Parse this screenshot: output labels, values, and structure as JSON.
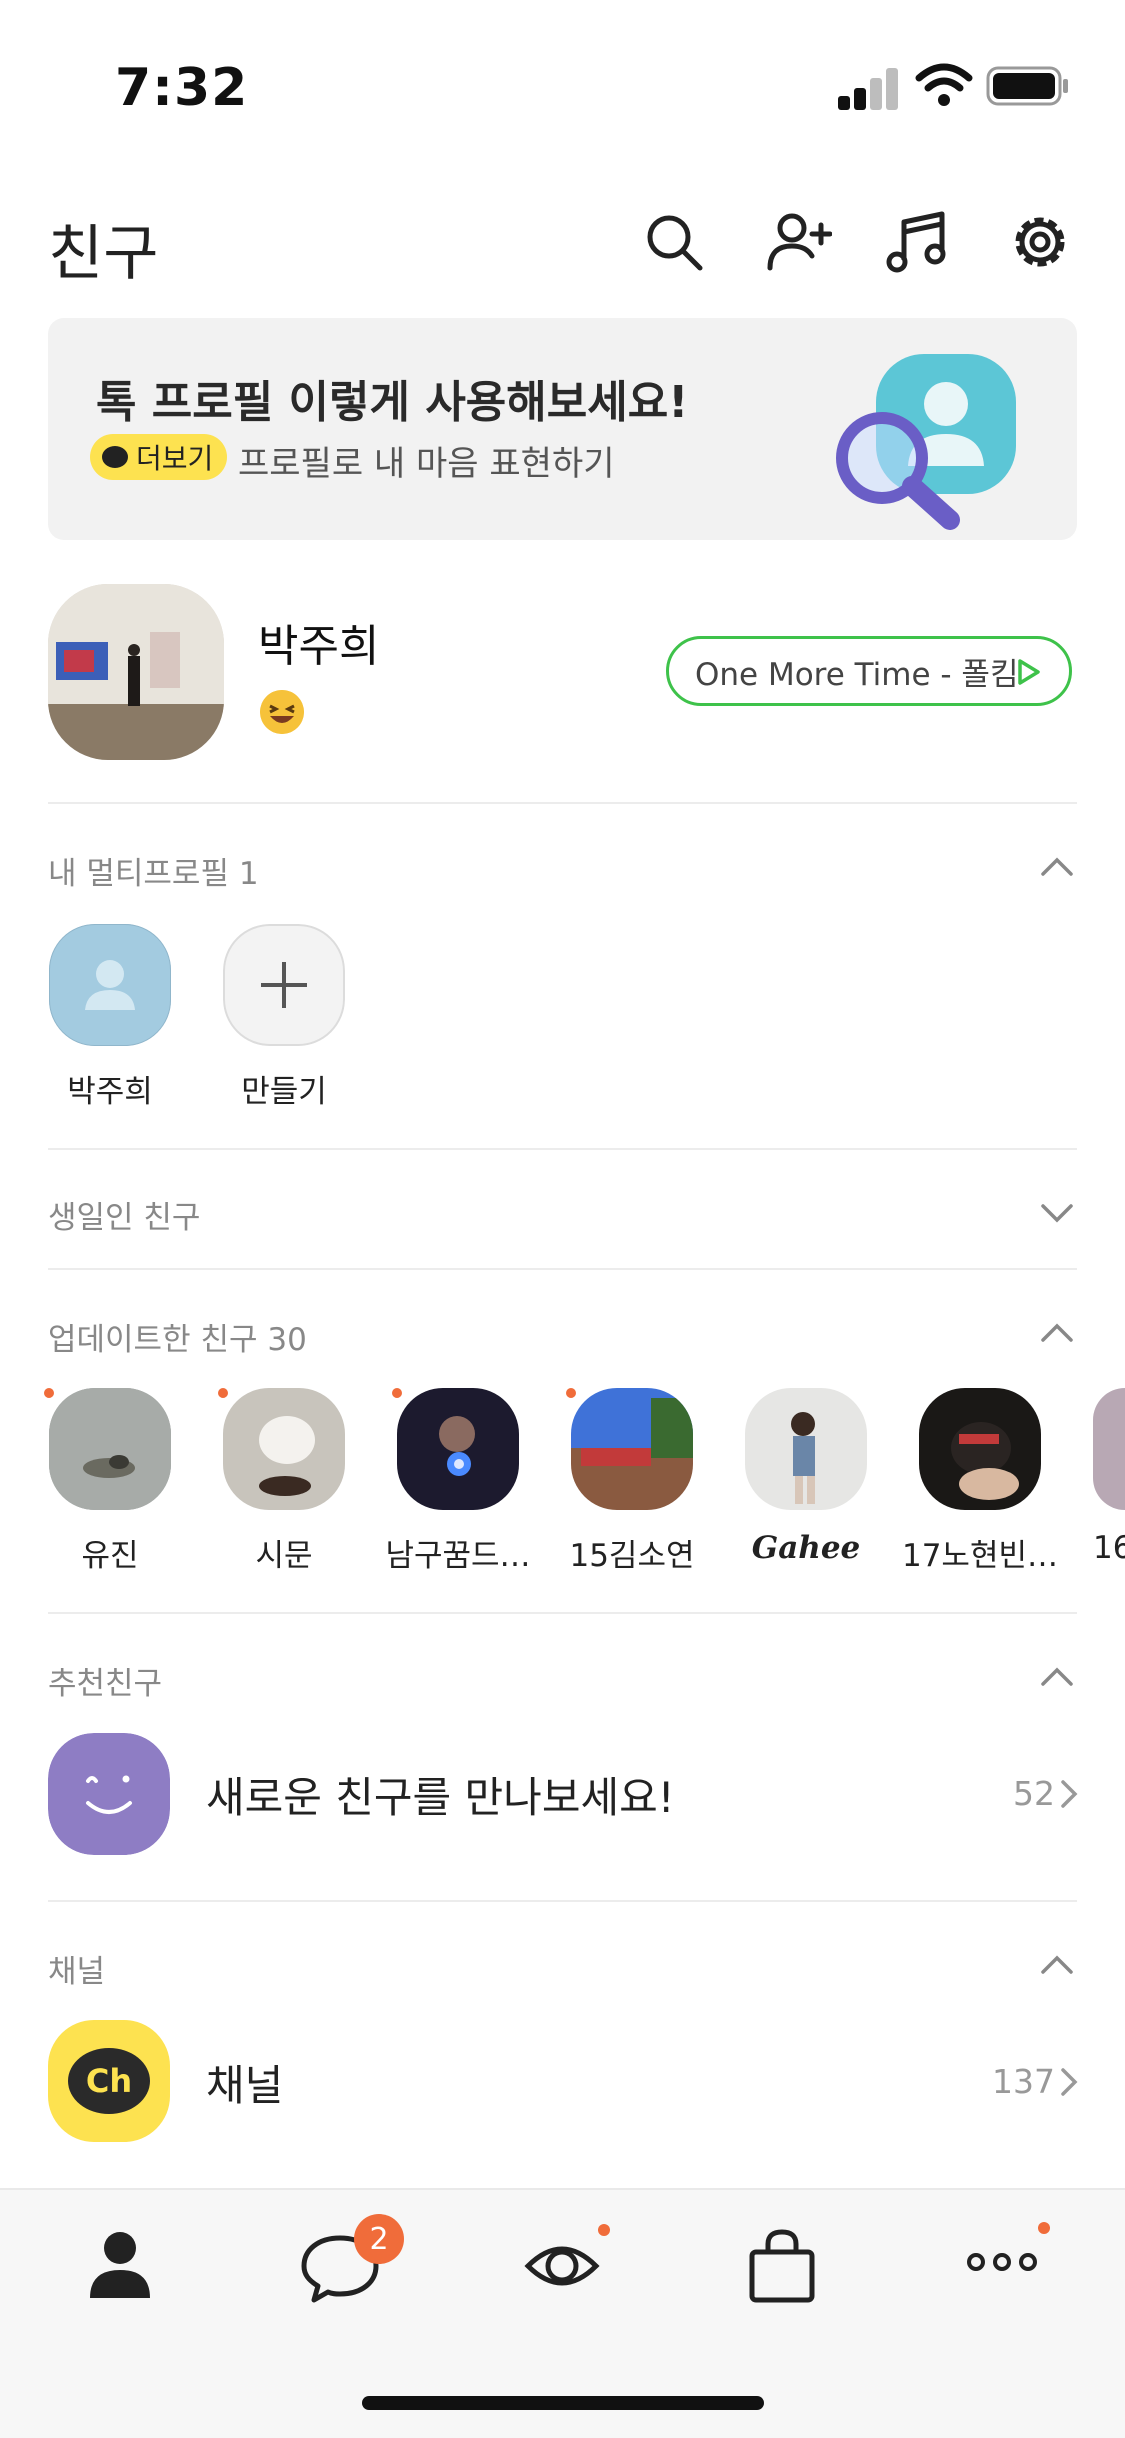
{
  "status": {
    "time": "7:32"
  },
  "header": {
    "title": "친구"
  },
  "banner": {
    "title": "톡 프로필 이렇게 사용해보세요!",
    "chip": "더보기",
    "subtitle": "프로필로 내 마음 표현하기"
  },
  "profile": {
    "name": "박주희",
    "music": "One More Time - 폴킴"
  },
  "multi_profile": {
    "label": "내 멀티프로필 1",
    "items": [
      "박주희",
      "만들기"
    ]
  },
  "birthday": {
    "label": "생일인 친구"
  },
  "updated": {
    "label": "업데이트한 친구 30",
    "friends": [
      "유진",
      "시문",
      "남구꿈드…",
      "15김소연",
      "Gahee",
      "17노현빈…",
      "16"
    ]
  },
  "recommend": {
    "label": "추천친구",
    "text": "새로운 친구를 만나보세요!",
    "count": "52"
  },
  "channel": {
    "label": "채널",
    "icon_text": "Ch",
    "text": "채널",
    "count": "137"
  },
  "tabs": {
    "chat_badge": "2"
  },
  "colors": {
    "accent_green": "#3ec24a",
    "kakao_yellow": "#fde250",
    "notify": "#f06c3a",
    "purple": "#8e7dc4"
  }
}
